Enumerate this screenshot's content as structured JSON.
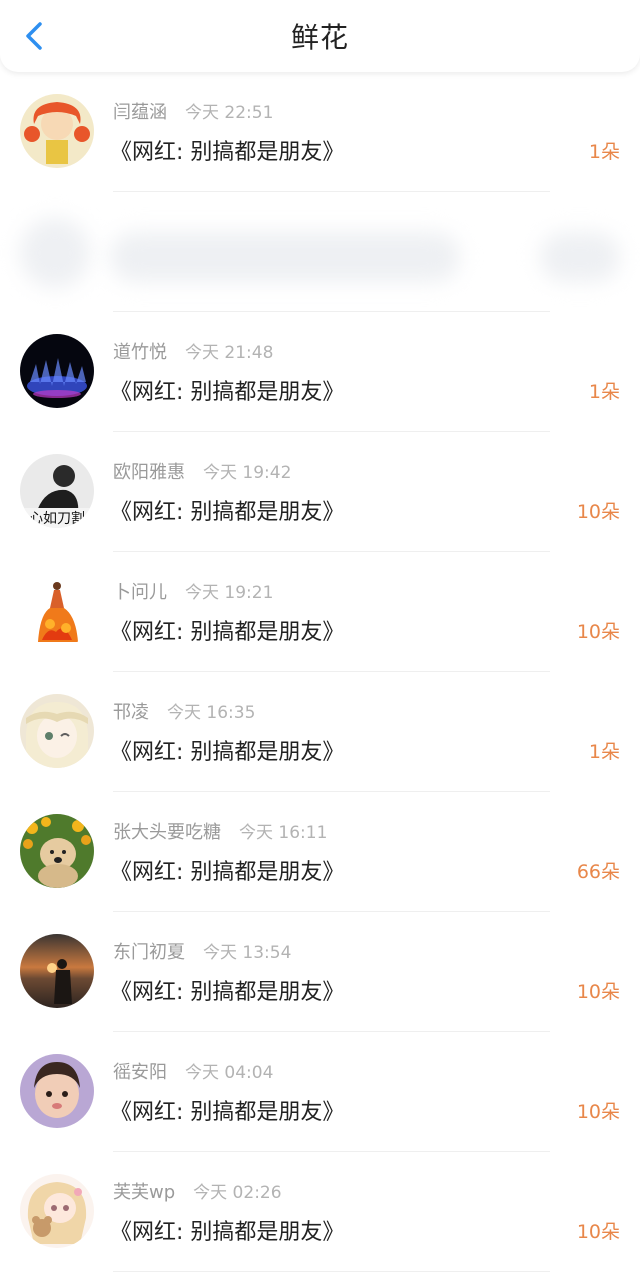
{
  "header": {
    "title": "鲜花",
    "back_icon": "chevron-left-icon"
  },
  "colors": {
    "accent": "#2e8ff0",
    "count": "#e8874a"
  },
  "rows": [
    {
      "name": "闫蕴涵",
      "time": "今天 22:51",
      "subject": "《网红: 别搞都是朋友》",
      "count": "1朵"
    },
    {
      "name": "",
      "time": "",
      "subject": "",
      "count": "",
      "blurred": true
    },
    {
      "name": "道竹悦",
      "time": "今天 21:48",
      "subject": "《网红: 别搞都是朋友》",
      "count": "1朵"
    },
    {
      "name": "欧阳雅惠",
      "time": "今天 19:42",
      "subject": "《网红: 别搞都是朋友》",
      "count": "10朵"
    },
    {
      "name": "卜问儿",
      "time": "今天 19:21",
      "subject": "《网红: 别搞都是朋友》",
      "count": "10朵"
    },
    {
      "name": "邗凌",
      "time": "今天 16:35",
      "subject": "《网红: 别搞都是朋友》",
      "count": "1朵"
    },
    {
      "name": "张大头要吃糖",
      "time": "今天 16:11",
      "subject": "《网红: 别搞都是朋友》",
      "count": "66朵"
    },
    {
      "name": "东门初夏",
      "time": "今天 13:54",
      "subject": "《网红: 别搞都是朋友》",
      "count": "10朵"
    },
    {
      "name": "徭安阳",
      "time": "今天 04:04",
      "subject": "《网红: 别搞都是朋友》",
      "count": "10朵"
    },
    {
      "name": "芙芙wp",
      "time": "今天 02:26",
      "subject": "《网红: 别搞都是朋友》",
      "count": "10朵"
    }
  ],
  "avatar_overlay_text": "心如刀割"
}
